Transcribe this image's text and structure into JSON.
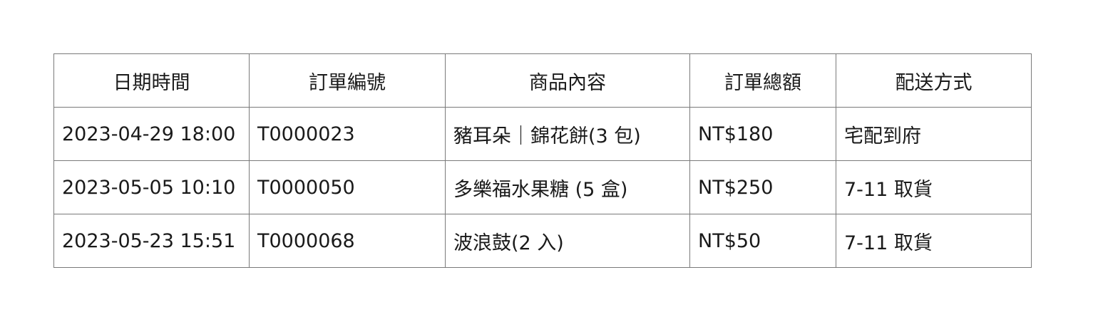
{
  "table": {
    "headers": [
      "日期時間",
      "訂單編號",
      "商品內容",
      "訂單總額",
      "配送方式"
    ],
    "rows": [
      [
        "2023-04-29 18:00",
        "T0000023",
        "豬耳朵｜錦花餅(3 包)",
        "NT$180",
        "宅配到府"
      ],
      [
        "2023-05-05 10:10",
        "T0000050",
        "多樂福水果糖  (5 盒)",
        "NT$250",
        "7-11 取貨"
      ],
      [
        "2023-05-23 15:51",
        "T0000068",
        "波浪鼓(2 入)",
        "NT$50",
        "7-11 取貨"
      ]
    ]
  }
}
